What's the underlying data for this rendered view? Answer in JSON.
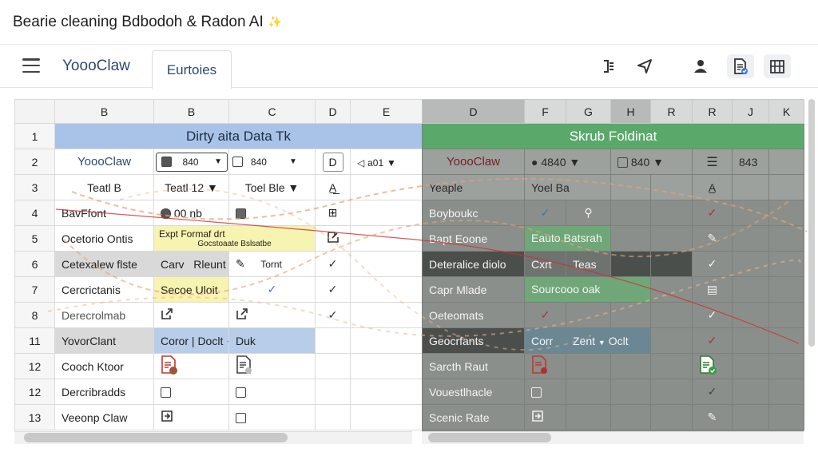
{
  "window_title": "Bearie cleaning Bdbodoh & Radon AI",
  "window_title_suffix": "✨",
  "app": {
    "brand": "YoooClaw",
    "tab": "Eurtoies"
  },
  "toolbar_icons": [
    "bracket-icon",
    "send-icon",
    "person-icon",
    "doc-check-icon",
    "map-icon"
  ],
  "left": {
    "col_headers": [
      "B",
      "B",
      "C",
      "D",
      "E"
    ],
    "title": "Dirty aita Data Tk",
    "row_numbers": [
      "1",
      "2",
      "3",
      "4",
      "5",
      "6",
      "7",
      "8",
      "11",
      "12",
      "12",
      "13"
    ],
    "r2_label": "YoooClaw",
    "r2_dd1": "840",
    "r2_dd2": "840",
    "r2_dd3": "a01",
    "r3_a": "Teatl B",
    "r3_b": "Teatl 12",
    "r3_c": "Toel Ble",
    "r3_d": "A̲̲",
    "r4_a": "BavFfont",
    "r4_b": "00 nb",
    "r5_a": "Ocetorio Ontis",
    "r5_b1": "Expt Formaf drt",
    "r5_b2": "Gocstoaate Bslsatbe",
    "r6_a": "Cetexalew flste",
    "r6_b": "Carv",
    "r6_c": "Rleunt",
    "r6_d": "Tornt",
    "r7_a": "Cercrictanis",
    "r7_b": "Secoe Uloit",
    "r8_a": "Derecrolmab",
    "r11_a": "YovorClant",
    "r11_b": "Coror",
    "r11_c": "Doclt",
    "r11_d": "Duk",
    "r12a_a": "Cooch Ktoor",
    "r12b_a": "Dercribradds",
    "r13_a": "Veeonp Claw"
  },
  "right": {
    "col_headers": [
      "D",
      "F",
      "G",
      "H",
      "R",
      "R",
      "J",
      "K"
    ],
    "title": "Skrub Foldinat",
    "r2_label": "YoooClaw",
    "r2_dd1": "4840",
    "r2_dd2": "840",
    "r2_end": "843",
    "r3_a": "Yeaple",
    "r3_b": "Yoel Ba",
    "r4_a": "Boyboukc",
    "r5_a": "Bapt Eoone",
    "r5_b": "Eauto Batsrah",
    "r6_a": "Deteralice diolo",
    "r6_b": "Cxrt",
    "r6_c": "Teas",
    "r7_a": "Capr Mlade",
    "r7_b": "Sourcooo oak",
    "r8_a": "Oeteomats",
    "r11_a": "Geocrfants",
    "r11_b": "Corr",
    "r11_c": "Zent",
    "r11_d": "Oclt",
    "r12a_a": "Sarcth Raut",
    "r12b_a": "Vouestlhacle",
    "r13_a": "Scenic Rate"
  }
}
